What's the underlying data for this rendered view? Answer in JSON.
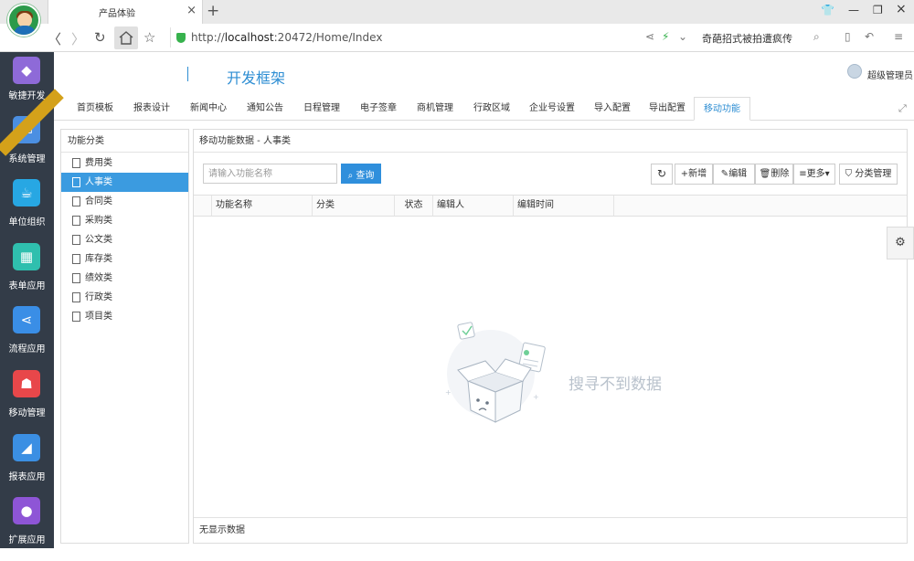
{
  "browser": {
    "tab_title": "产品体验",
    "tab_close": "×",
    "new_tab": "+",
    "url_prefix": "http://",
    "url_host": "localhost",
    "url_rest": ":20472/Home/Index",
    "search_hint": "奇葩招式被拍遭疯传",
    "icons": [
      "avatar-icon",
      "back-icon",
      "forward-icon",
      "reload-icon",
      "home-icon",
      "star-icon",
      "shield-icon",
      "share-icon",
      "lightning-icon",
      "search-icon",
      "phone-icon",
      "undo-icon",
      "menu-icon"
    ]
  },
  "leftnav": {
    "items": [
      {
        "label": "敏捷开发",
        "icon": "agile-icon",
        "color": "#8e6ad8"
      },
      {
        "label": "系统管理",
        "icon": "monitor-icon",
        "color": "#4b8fe2"
      },
      {
        "label": "单位组织",
        "icon": "cup-icon",
        "color": "#27a7e3"
      },
      {
        "label": "表单应用",
        "icon": "grid-icon",
        "color": "#2fbfae"
      },
      {
        "label": "流程应用",
        "icon": "share-icon",
        "color": "#3a8ee6"
      },
      {
        "label": "移动管理",
        "icon": "android-icon",
        "color": "#e8474a"
      },
      {
        "label": "报表应用",
        "icon": "chart-icon",
        "color": "#3b8fe3"
      },
      {
        "label": "扩展应用",
        "icon": "planet-icon",
        "color": "#8e55d6"
      }
    ]
  },
  "header": {
    "brand": "开发框架",
    "user_name": "超级管理员"
  },
  "tabs": [
    {
      "label": "首页模板"
    },
    {
      "label": "报表设计"
    },
    {
      "label": "新闻中心"
    },
    {
      "label": "通知公告"
    },
    {
      "label": "日程管理"
    },
    {
      "label": "电子签章"
    },
    {
      "label": "商机管理"
    },
    {
      "label": "行政区域"
    },
    {
      "label": "企业号设置"
    },
    {
      "label": "导入配置"
    },
    {
      "label": "导出配置"
    },
    {
      "label": "移动功能"
    }
  ],
  "active_tab": "移动功能",
  "category": {
    "title": "功能分类",
    "items": [
      "费用类",
      "人事类",
      "合同类",
      "采购类",
      "公文类",
      "库存类",
      "绩效类",
      "行政类",
      "项目类"
    ],
    "selected": "人事类"
  },
  "main": {
    "title": "移动功能数据 - 人事类",
    "search_placeholder": "请输入功能名称",
    "query_label": "查询",
    "toolbar": {
      "refresh": "↻",
      "add": "+新增",
      "edit": "编辑",
      "delete": "删除",
      "more": "≡更多▾",
      "category_manage": "分类管理"
    },
    "columns": [
      "功能名称",
      "分类",
      "状态",
      "编辑人",
      "编辑时间"
    ],
    "rows": [],
    "empty_text": "搜寻不到数据",
    "footer": "无显示数据"
  },
  "colors": {
    "accent": "#2e8ed3",
    "nav_bg": "#333c48",
    "selected_row": "#3b9be0",
    "primary_button": "#2f8fdc"
  }
}
